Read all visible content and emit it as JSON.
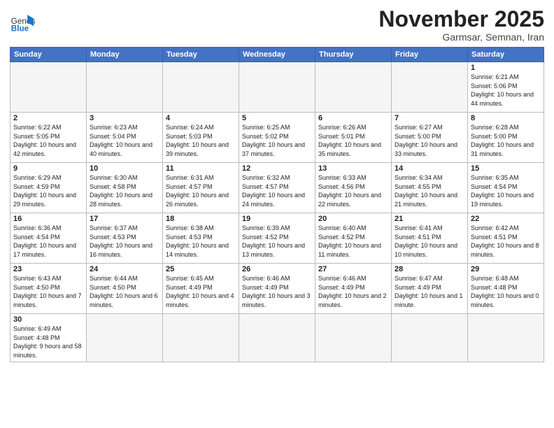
{
  "header": {
    "logo_general": "General",
    "logo_blue": "Blue",
    "month_title": "November 2025",
    "subtitle": "Garmsar, Semnan, Iran"
  },
  "weekdays": [
    "Sunday",
    "Monday",
    "Tuesday",
    "Wednesday",
    "Thursday",
    "Friday",
    "Saturday"
  ],
  "weeks": [
    [
      {
        "day": "",
        "empty": true
      },
      {
        "day": "",
        "empty": true
      },
      {
        "day": "",
        "empty": true
      },
      {
        "day": "",
        "empty": true
      },
      {
        "day": "",
        "empty": true
      },
      {
        "day": "",
        "empty": true
      },
      {
        "day": "1",
        "sunrise": "6:21 AM",
        "sunset": "5:06 PM",
        "daylight": "10 hours and 44 minutes."
      }
    ],
    [
      {
        "day": "2",
        "sunrise": "6:22 AM",
        "sunset": "5:05 PM",
        "daylight": "10 hours and 42 minutes."
      },
      {
        "day": "3",
        "sunrise": "6:23 AM",
        "sunset": "5:04 PM",
        "daylight": "10 hours and 40 minutes."
      },
      {
        "day": "4",
        "sunrise": "6:24 AM",
        "sunset": "5:03 PM",
        "daylight": "10 hours and 39 minutes."
      },
      {
        "day": "5",
        "sunrise": "6:25 AM",
        "sunset": "5:02 PM",
        "daylight": "10 hours and 37 minutes."
      },
      {
        "day": "6",
        "sunrise": "6:26 AM",
        "sunset": "5:01 PM",
        "daylight": "10 hours and 35 minutes."
      },
      {
        "day": "7",
        "sunrise": "6:27 AM",
        "sunset": "5:00 PM",
        "daylight": "10 hours and 33 minutes."
      },
      {
        "day": "8",
        "sunrise": "6:28 AM",
        "sunset": "5:00 PM",
        "daylight": "10 hours and 31 minutes."
      }
    ],
    [
      {
        "day": "9",
        "sunrise": "6:29 AM",
        "sunset": "4:59 PM",
        "daylight": "10 hours and 29 minutes."
      },
      {
        "day": "10",
        "sunrise": "6:30 AM",
        "sunset": "4:58 PM",
        "daylight": "10 hours and 28 minutes."
      },
      {
        "day": "11",
        "sunrise": "6:31 AM",
        "sunset": "4:57 PM",
        "daylight": "10 hours and 26 minutes."
      },
      {
        "day": "12",
        "sunrise": "6:32 AM",
        "sunset": "4:57 PM",
        "daylight": "10 hours and 24 minutes."
      },
      {
        "day": "13",
        "sunrise": "6:33 AM",
        "sunset": "4:56 PM",
        "daylight": "10 hours and 22 minutes."
      },
      {
        "day": "14",
        "sunrise": "6:34 AM",
        "sunset": "4:55 PM",
        "daylight": "10 hours and 21 minutes."
      },
      {
        "day": "15",
        "sunrise": "6:35 AM",
        "sunset": "4:54 PM",
        "daylight": "10 hours and 19 minutes."
      }
    ],
    [
      {
        "day": "16",
        "sunrise": "6:36 AM",
        "sunset": "4:54 PM",
        "daylight": "10 hours and 17 minutes."
      },
      {
        "day": "17",
        "sunrise": "6:37 AM",
        "sunset": "4:53 PM",
        "daylight": "10 hours and 16 minutes."
      },
      {
        "day": "18",
        "sunrise": "6:38 AM",
        "sunset": "4:53 PM",
        "daylight": "10 hours and 14 minutes."
      },
      {
        "day": "19",
        "sunrise": "6:39 AM",
        "sunset": "4:52 PM",
        "daylight": "10 hours and 13 minutes."
      },
      {
        "day": "20",
        "sunrise": "6:40 AM",
        "sunset": "4:52 PM",
        "daylight": "10 hours and 11 minutes."
      },
      {
        "day": "21",
        "sunrise": "6:41 AM",
        "sunset": "4:51 PM",
        "daylight": "10 hours and 10 minutes."
      },
      {
        "day": "22",
        "sunrise": "6:42 AM",
        "sunset": "4:51 PM",
        "daylight": "10 hours and 8 minutes."
      }
    ],
    [
      {
        "day": "23",
        "sunrise": "6:43 AM",
        "sunset": "4:50 PM",
        "daylight": "10 hours and 7 minutes."
      },
      {
        "day": "24",
        "sunrise": "6:44 AM",
        "sunset": "4:50 PM",
        "daylight": "10 hours and 6 minutes."
      },
      {
        "day": "25",
        "sunrise": "6:45 AM",
        "sunset": "4:49 PM",
        "daylight": "10 hours and 4 minutes."
      },
      {
        "day": "26",
        "sunrise": "6:46 AM",
        "sunset": "4:49 PM",
        "daylight": "10 hours and 3 minutes."
      },
      {
        "day": "27",
        "sunrise": "6:46 AM",
        "sunset": "4:49 PM",
        "daylight": "10 hours and 2 minutes."
      },
      {
        "day": "28",
        "sunrise": "6:47 AM",
        "sunset": "4:49 PM",
        "daylight": "10 hours and 1 minute."
      },
      {
        "day": "29",
        "sunrise": "6:48 AM",
        "sunset": "4:48 PM",
        "daylight": "10 hours and 0 minutes."
      }
    ],
    [
      {
        "day": "30",
        "sunrise": "6:49 AM",
        "sunset": "4:48 PM",
        "daylight": "9 hours and 58 minutes."
      },
      {
        "day": "",
        "empty": true
      },
      {
        "day": "",
        "empty": true
      },
      {
        "day": "",
        "empty": true
      },
      {
        "day": "",
        "empty": true
      },
      {
        "day": "",
        "empty": true
      },
      {
        "day": "",
        "empty": true
      }
    ]
  ]
}
